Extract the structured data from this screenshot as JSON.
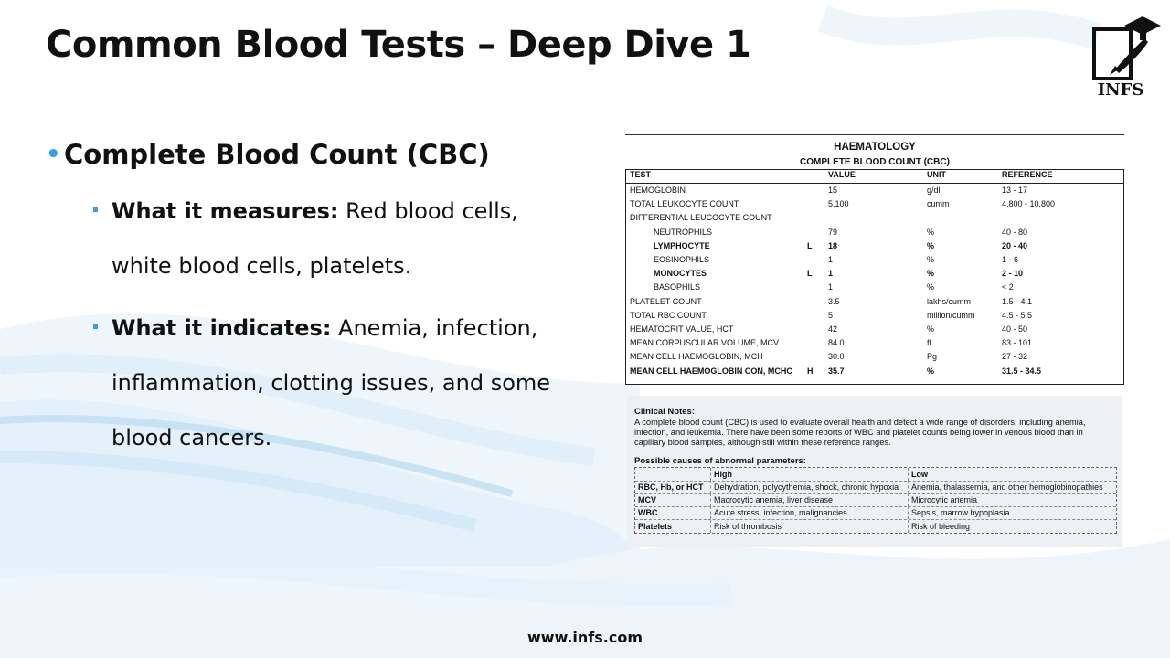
{
  "title": "Common Blood Tests – Deep Dive 1",
  "logo_text": "INFS",
  "bullet": {
    "heading": "Complete Blood Count (CBC)",
    "items": [
      {
        "label": "What it measures:",
        "text": " Red blood cells, white blood cells, platelets."
      },
      {
        "label": "What it indicates:",
        "text": " Anemia, infection, inflammation, clotting issues, and some blood cancers."
      }
    ]
  },
  "report": {
    "section": "HAEMATOLOGY",
    "subtitle": "COMPLETE BLOOD COUNT (CBC)",
    "columns": [
      "TEST",
      "VALUE",
      "UNIT",
      "REFERENCE"
    ],
    "rows": [
      {
        "test": "HEMOGLOBIN",
        "flag": "",
        "value": "15",
        "unit": "g/dl",
        "ref": "13 - 17"
      },
      {
        "test": "TOTAL LEUKOCYTE COUNT",
        "flag": "",
        "value": "5,100",
        "unit": "cumm",
        "ref": "4,800 - 10,800"
      },
      {
        "test": "DIFFERENTIAL LEUCOCYTE COUNT",
        "flag": "",
        "value": "",
        "unit": "",
        "ref": ""
      },
      {
        "test": "NEUTROPHILS",
        "flag": "",
        "value": "79",
        "unit": "%",
        "ref": "40 - 80"
      },
      {
        "test": "LYMPHOCYTE",
        "flag": "L",
        "value": "18",
        "unit": "%",
        "ref": "20 - 40"
      },
      {
        "test": "EOSINOPHILS",
        "flag": "",
        "value": "1",
        "unit": "%",
        "ref": "1 - 6"
      },
      {
        "test": "MONOCYTES",
        "flag": "L",
        "value": "1",
        "unit": "%",
        "ref": "2 - 10"
      },
      {
        "test": "BASOPHILS",
        "flag": "",
        "value": "1",
        "unit": "%",
        "ref": "< 2"
      },
      {
        "test": "PLATELET COUNT",
        "flag": "",
        "value": "3.5",
        "unit": "lakhs/cumm",
        "ref": "1.5 - 4.1"
      },
      {
        "test": "TOTAL RBC COUNT",
        "flag": "",
        "value": "5",
        "unit": "million/cumm",
        "ref": "4.5 - 5.5"
      },
      {
        "test": "HEMATOCRIT VALUE, HCT",
        "flag": "",
        "value": "42",
        "unit": "%",
        "ref": "40 - 50"
      },
      {
        "test": "MEAN CORPUSCULAR VOLUME, MCV",
        "flag": "",
        "value": "84.0",
        "unit": "fL",
        "ref": "83 - 101"
      },
      {
        "test": "MEAN CELL HAEMOGLOBIN, MCH",
        "flag": "",
        "value": "30.0",
        "unit": "Pg",
        "ref": "27 - 32"
      },
      {
        "test": "MEAN CELL HAEMOGLOBIN CON, MCHC",
        "flag": "H",
        "value": "35.7",
        "unit": "%",
        "ref": "31.5 - 34.5"
      }
    ],
    "clinical_title": "Clinical Notes:",
    "clinical_text": "A complete blood count (CBC) is used to evaluate overall health and detect a wide range of disorders, including anemia, infection, and leukemia. There have been some reports of WBC and platelet counts being lower in venous blood than in capillary blood samples, although still within these reference ranges.",
    "causes_title": "Possible causes of abnormal parameters:",
    "causes_header": [
      "",
      "High",
      "Low"
    ],
    "causes": [
      {
        "param": "RBC, Hb, or HCT",
        "high": "Dehydration, polycythemia, shock, chronic hypoxia",
        "low": "Anemia, thalassemia, and other hemoglobinopathies"
      },
      {
        "param": "MCV",
        "high": "Macrocytic anemia, liver disease",
        "low": "Microcytic anemia"
      },
      {
        "param": "WBC",
        "high": "Acute stress, infection, malignancies",
        "low": "Sepsis, marrow hypoplasia"
      },
      {
        "param": "Platelets",
        "high": "Risk of thrombosis",
        "low": "Risk of bleeding"
      }
    ]
  },
  "footer": "www.infs.com",
  "colors": {
    "accent": "#3aa0dd",
    "wave": "#cfe6f5"
  }
}
